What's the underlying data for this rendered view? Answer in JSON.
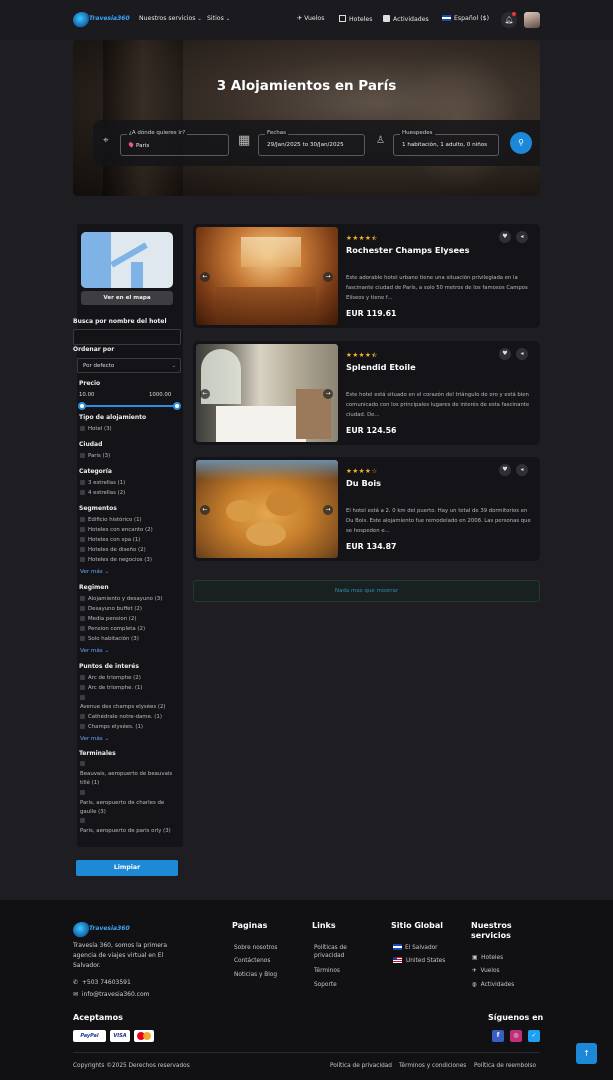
{
  "header": {
    "logo_text": "Travesia360",
    "nav": {
      "services": "Nuestros servicios",
      "sites": "Sitios",
      "flights": "Vuelos",
      "hotels": "Hoteles",
      "activities": "Actividades",
      "language": "Español ($)"
    }
  },
  "hero": {
    "title": "3 Alojamientos en París",
    "destination_label": "¿A dónde quieres ir?",
    "destination_value": "Paris",
    "dates_label": "Fechas",
    "dates_value": "29/Jan/2025 to 30/Jan/2025",
    "guests_label": "Huespedes",
    "guests_value": "1 habitación, 1 adulto, 0 niños"
  },
  "sidebar": {
    "map_button": "Ver en el mapa",
    "search_name_label": "Busca por nombre del hotel",
    "sort_label": "Ordenar por",
    "sort_value": "Por defecto",
    "price_label": "Precio",
    "price_min": "10.00",
    "price_max": "1000.00",
    "lodging_type_label": "Tipo de alojamiento",
    "lodging_types": [
      "Hotel (3)"
    ],
    "city_label": "Ciudad",
    "cities": [
      "Paris (3)"
    ],
    "category_label": "Categoría",
    "categories": [
      "3 estrellas (1)",
      "4 estrellas (2)"
    ],
    "segments_label": "Segmentos",
    "segments": [
      "Edificio histórico (1)",
      "Hoteles con encanto (2)",
      "Hoteles con spa (1)",
      "Hoteles de diseño (2)",
      "Hoteles de negocios (3)"
    ],
    "regime_label": "Regimen",
    "regimes": [
      "Alojamiento y desayuno (3)",
      "Desayuno buffet (2)",
      "Media pension (2)",
      "Pension completa (2)",
      "Solo habitación (3)"
    ],
    "poi_label": "Puntos de interés",
    "pois": [
      "Arc de triomphe (2)",
      "Arc de triomphe. (1)",
      "",
      "Avenue des champs elysées (2)",
      "Cathédrale notre-dame. (1)",
      "Champs elysées. (1)"
    ],
    "terminals_label": "Terminales",
    "terminals": [
      "Beauvais, aeropuerto de beauvais tillé (1)",
      "Paris, aeropuerto de charles de gaulle (3)",
      "Paris, aeropuerto de paris orly (3)"
    ],
    "see_more": "Ver más",
    "clear_button": "Limpiar"
  },
  "results": [
    {
      "name": "Rochester Champs Elysees",
      "rating": 4.5,
      "subtitle": "",
      "description": "Este adorable hotel urbano tiene una situación privilegiada en la fascinante ciudad de París, a solo 50 metros de los famosos Campos Elíseos y tiene f...",
      "price": "EUR 119.61",
      "price_note": ""
    },
    {
      "name": "Splendid Etoile",
      "rating": 4.5,
      "subtitle": "",
      "description": "Este hotel está situado en el corazón del triángulo de oro y está bien comunicado con los principales lugares de interés de esta fascinante ciudad. De...",
      "price": "EUR 124.56",
      "price_note": ""
    },
    {
      "name": "Du Bois",
      "rating": 4,
      "subtitle": "",
      "description": "El hotel está a 2. 0 km del puerto. Hay un total de 39 dormitorios en Du Bois. Este alojamiento fue remodelado en 2008. Las personas que se hospeden e...",
      "price": "EUR 134.87",
      "price_note": ""
    }
  ],
  "no_more": "Nada mas que mostrar",
  "footer": {
    "about": "Travesía 360, somos la primera agencia de viajes virtual en El Salvador.",
    "phone": "+503 74603591",
    "email": "info@travesia360.com",
    "pages_title": "Paginas",
    "pages": [
      "Sobre nosotros",
      "Contáctenos",
      "Noticias y Blog"
    ],
    "links_title": "Links",
    "links": [
      "Políticas de privacidad",
      "Términos",
      "Soporte"
    ],
    "global_title": "Sitio Global",
    "global": [
      "El Salvador",
      "United States"
    ],
    "services_title": "Nuestros servicios",
    "services": [
      "Hoteles",
      "Vuelos",
      "Actividades"
    ],
    "accept_title": "Aceptamos",
    "payments": [
      "PayPal",
      "VISA",
      "mastercard"
    ],
    "social_title": "Síguenos en",
    "copyright": "Copyrights ©2025 Derechos reservados",
    "legal": [
      "Política de privacidad",
      "Términos y condiciones",
      "Política de reembolso"
    ]
  }
}
